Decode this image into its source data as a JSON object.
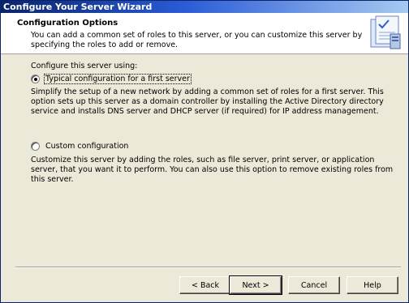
{
  "window": {
    "title": "Configure Your Server Wizard"
  },
  "header": {
    "title": "Configuration Options",
    "description": "You can add a common set of roles to this server, or you can customize this server by specifying the roles to add or remove.",
    "icon": "server-wizard-icon"
  },
  "main": {
    "prompt": "Configure this server using:",
    "options": [
      {
        "label": "Typical configuration for a first server",
        "selected": true,
        "description": "Simplify the setup of a new network by adding a common set of roles for a first server. This option sets up this server as a domain controller by installing the Active Directory directory service and installs DNS server and DHCP server (if required) for IP address management."
      },
      {
        "label": "Custom configuration",
        "selected": false,
        "description": "Customize this server by adding the roles, such as file server, print server, or application server, that you want it to perform. You can also use this option to remove existing roles from this server."
      }
    ]
  },
  "buttons": {
    "back": "< Back",
    "next": "Next >",
    "cancel": "Cancel",
    "help": "Help"
  }
}
